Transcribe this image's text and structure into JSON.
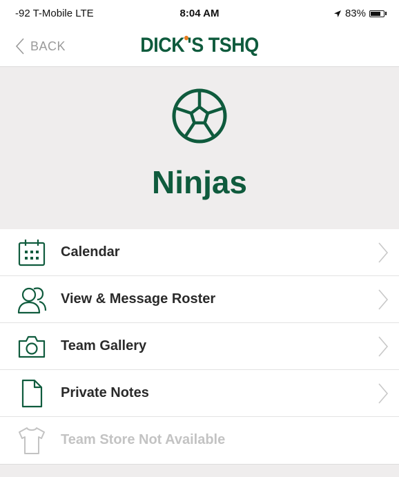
{
  "status_bar": {
    "carrier": "-92 T-Mobile  LTE",
    "time": "8:04 AM",
    "battery_text": "83%",
    "battery_level": 0.83
  },
  "nav": {
    "back_label": "BACK",
    "logo_text_a": "DICK",
    "logo_text_b": "'S TSHQ"
  },
  "team": {
    "name": "Ninjas",
    "sport_icon": "soccer-ball-icon"
  },
  "menu": [
    {
      "label": "Calendar",
      "icon": "calendar-icon",
      "enabled": true
    },
    {
      "label": "View & Message Roster",
      "icon": "people-icon",
      "enabled": true
    },
    {
      "label": "Team Gallery",
      "icon": "camera-icon",
      "enabled": true
    },
    {
      "label": "Private Notes",
      "icon": "note-icon",
      "enabled": true
    },
    {
      "label": "Team Store Not Available",
      "icon": "shirt-icon",
      "enabled": false
    }
  ],
  "colors": {
    "brand_green": "#0f5b3d",
    "accent_orange": "#e87c1e",
    "header_bg": "#efeded",
    "disabled_text": "#c3c3c3"
  }
}
